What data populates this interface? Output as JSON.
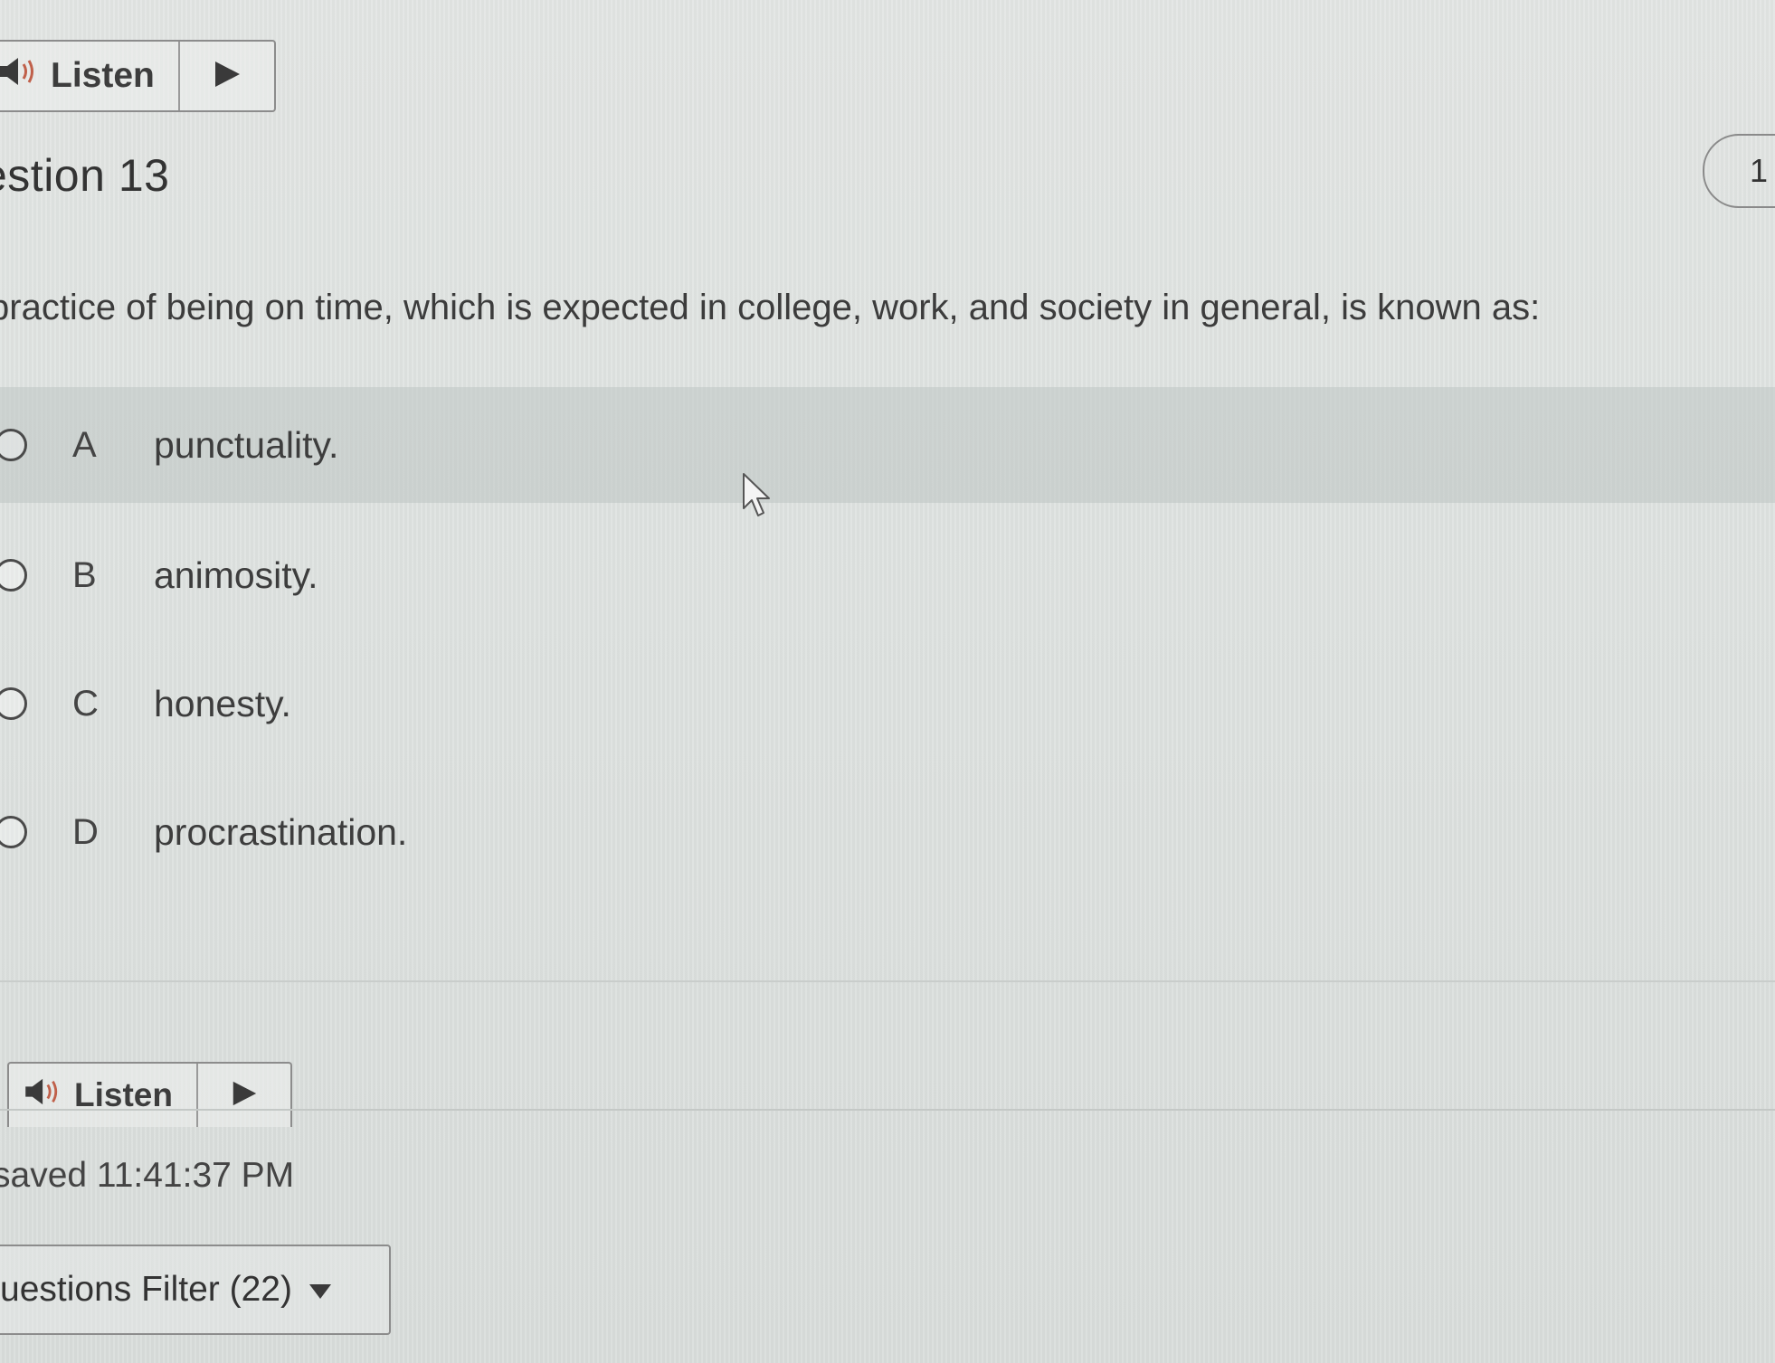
{
  "listen_top": {
    "label": "Listen",
    "play_icon": "play-icon",
    "speaker_icon": "speaker-icon"
  },
  "question": {
    "title": "estion 13",
    "points": "1",
    "text": "practice of being on time, which is expected in college, work, and society in general, is known as:"
  },
  "options": [
    {
      "letter": "A",
      "text": "punctuality.",
      "hovered": true
    },
    {
      "letter": "B",
      "text": "animosity."
    },
    {
      "letter": "C",
      "text": "honesty."
    },
    {
      "letter": "D",
      "text": "procrastination."
    }
  ],
  "listen_bottom": {
    "label": "Listen"
  },
  "status": {
    "saved_text": "saved 11:41:37 PM"
  },
  "filter": {
    "label": "uestions Filter (22)"
  },
  "colors": {
    "speaker_red": "#c0604a",
    "text": "#3c3c3c",
    "hover_row": "#c3c8c6"
  }
}
